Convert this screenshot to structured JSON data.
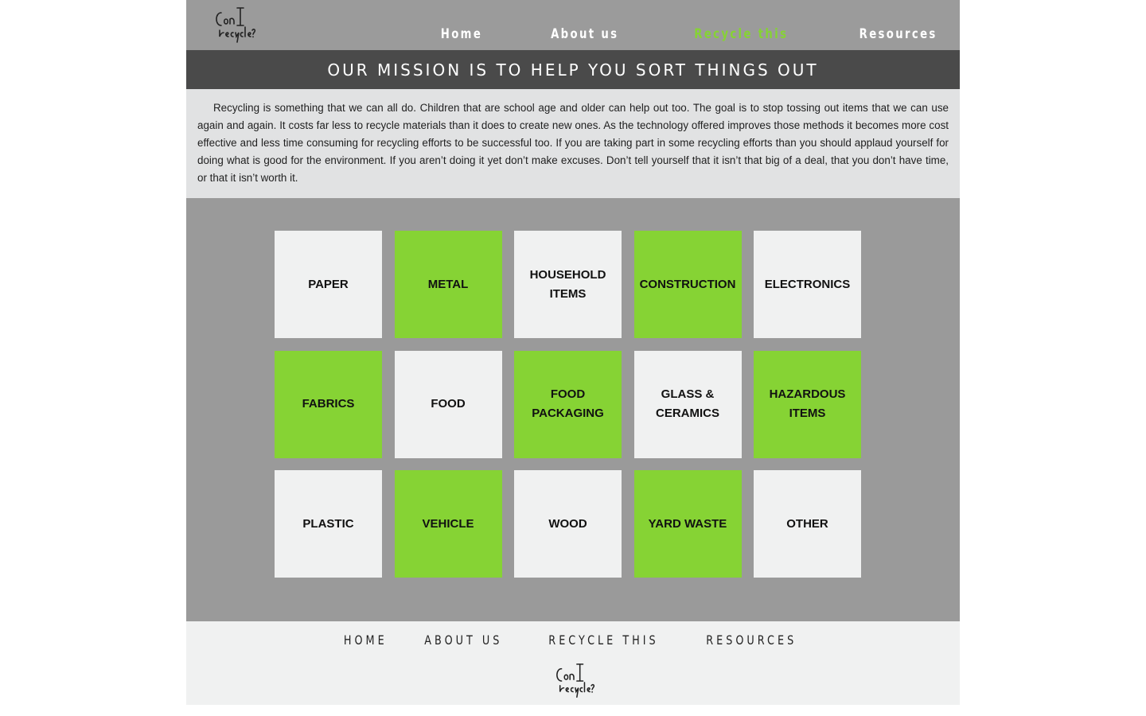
{
  "header": {
    "logo_text": "Can I recycle?",
    "nav": [
      {
        "label": "Home",
        "active": false
      },
      {
        "label": "About us",
        "active": false
      },
      {
        "label": "Recycle this",
        "active": true
      },
      {
        "label": "Resources",
        "active": false
      }
    ]
  },
  "banner": {
    "title": "OUR MISSION IS TO HELP YOU SORT THINGS OUT"
  },
  "intro": {
    "text": "Recycling is something that we can all do. Children that are school age and older can help out too. The goal is to stop tossing out items that we can use again and again. It costs far less to recycle materials than it does to create new ones. As the technology offered improves those methods it becomes more cost effective and less time consuming for recycling efforts to be successful too. If you are taking part in some recycling efforts than you should applaud yourself for doing what is good for the environment. If you aren’t doing it yet don’t make excuses. Don’t tell yourself that it isn’t that big of a deal, that you don’t have time, or that it isn’t worth it."
  },
  "categories": [
    {
      "label": "PAPER",
      "style": "light"
    },
    {
      "label": "METAL",
      "style": "green"
    },
    {
      "label": "HOUSEHOLD ITEMS",
      "style": "light"
    },
    {
      "label": "CONSTRUCTION",
      "style": "green"
    },
    {
      "label": "ELECTRONICS",
      "style": "light"
    },
    {
      "label": "FABRICS",
      "style": "green"
    },
    {
      "label": "FOOD",
      "style": "light"
    },
    {
      "label": "FOOD PACKAGING",
      "style": "green"
    },
    {
      "label": "GLASS & CERAMICS",
      "style": "light"
    },
    {
      "label": "HAZARDOUS ITEMS",
      "style": "green"
    },
    {
      "label": "PLASTIC",
      "style": "light"
    },
    {
      "label": "VEHICLE",
      "style": "green"
    },
    {
      "label": "WOOD",
      "style": "light"
    },
    {
      "label": "YARD WASTE",
      "style": "green"
    },
    {
      "label": "OTHER",
      "style": "light"
    }
  ],
  "footer": {
    "nav": [
      "HOME",
      "ABOUT US",
      "RECYCLE THIS",
      "RESOURCES"
    ],
    "logo_text": "Can I recycle?"
  },
  "colors": {
    "accent_green": "#86d334",
    "header_gray": "#9b9b9b",
    "banner_dark": "#4a4a4a",
    "tile_light": "#f0f1f1"
  }
}
